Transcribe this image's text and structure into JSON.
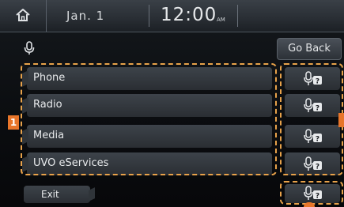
{
  "status_bar": {
    "date": "Jan.  1",
    "time": "12:00",
    "ampm": "AM"
  },
  "nav": {
    "go_back": "Go Back"
  },
  "menu": {
    "items": [
      {
        "label": "Phone"
      },
      {
        "label": "Radio"
      },
      {
        "label": "Media"
      },
      {
        "label": "UVO eServices"
      }
    ],
    "exit_label": "Exit"
  },
  "annotations": {
    "badge_1": "1"
  },
  "colors": {
    "annotation": "#e8a24a",
    "badge": "#e8752a",
    "text": "#e8eaec"
  },
  "icons": {
    "home": "home-icon",
    "microphone": "microphone-icon",
    "voice_help": "voice-help-icon"
  }
}
